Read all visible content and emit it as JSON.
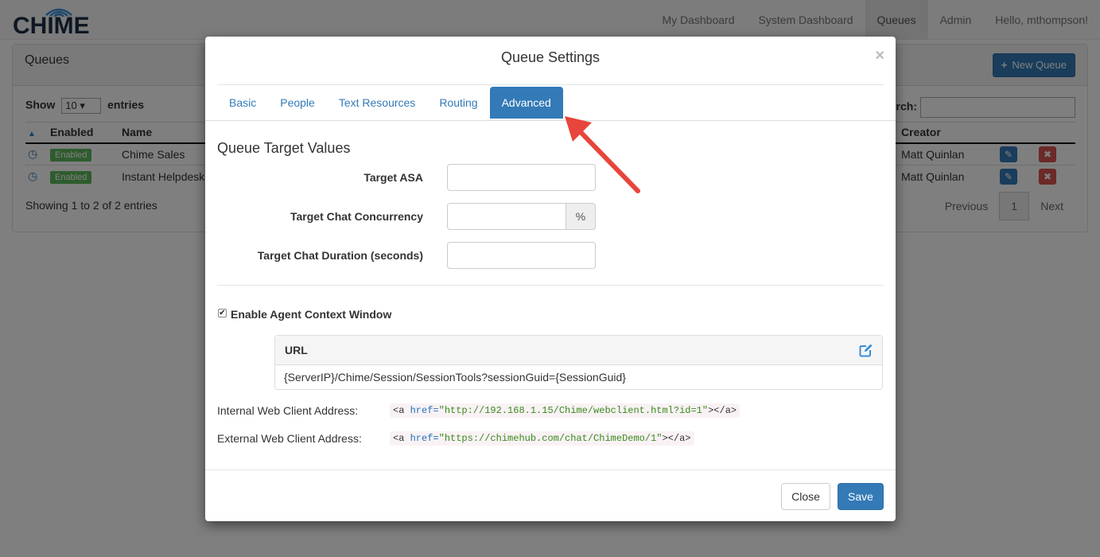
{
  "app": {
    "logo_text": "CHIME",
    "nav": [
      "My Dashboard",
      "System Dashboard",
      "Queues",
      "Admin",
      "Hello, mthompson!"
    ],
    "nav_active": "Queues"
  },
  "queues_panel": {
    "title": "Queues",
    "new_queue_label": "New Queue",
    "show_label": "Show",
    "entries_label": "entries",
    "page_size": "10",
    "search_label": "rch:",
    "columns": [
      "Enabled",
      "Name",
      "Creator"
    ],
    "rows": [
      {
        "enabled": "Enabled",
        "name": "Chime Sales",
        "creator": "Matt Quinlan"
      },
      {
        "enabled": "Enabled",
        "name": "Instant Helpdesk",
        "creator": "Matt Quinlan"
      }
    ],
    "showing_text": "Showing 1 to 2 of 2 entries",
    "pager": {
      "previous": "Previous",
      "current": "1",
      "next": "Next"
    }
  },
  "modal": {
    "title": "Queue Settings",
    "close_glyph": "×",
    "tabs": [
      "Basic",
      "People",
      "Text Resources",
      "Routing",
      "Advanced"
    ],
    "active_tab": "Advanced",
    "section_title": "Queue Target Values",
    "fields": {
      "target_asa": {
        "label": "Target ASA",
        "value": ""
      },
      "target_chat_concurrency": {
        "label": "Target Chat Concurrency",
        "value": "",
        "addon": "%"
      },
      "target_chat_duration": {
        "label": "Target Chat Duration (seconds)",
        "value": ""
      }
    },
    "agent_context": {
      "label": "Enable Agent Context Window",
      "checked": true,
      "url_title": "URL",
      "url_value": "{ServerIP}/Chime/Session/SessionTools?sessionGuid={SessionGuid}"
    },
    "internal_address": {
      "label": "Internal Web Client Address:",
      "tag_open": "<a ",
      "attr": "href=",
      "value": "\"http://192.168.1.15/Chime/webclient.html?id=1\"",
      "tag_close": "></a>"
    },
    "external_address": {
      "label": "External Web Client Address:",
      "tag_open": "<a ",
      "attr": "href=",
      "value": "\"https://chimehub.com/chat/ChimeDemo/1\"",
      "tag_close": "></a>"
    },
    "close_label": "Close",
    "save_label": "Save"
  },
  "colors": {
    "primary": "#337ab7",
    "success": "#5cb85c",
    "danger": "#d9534f",
    "annotation_arrow": "#e8453c"
  }
}
